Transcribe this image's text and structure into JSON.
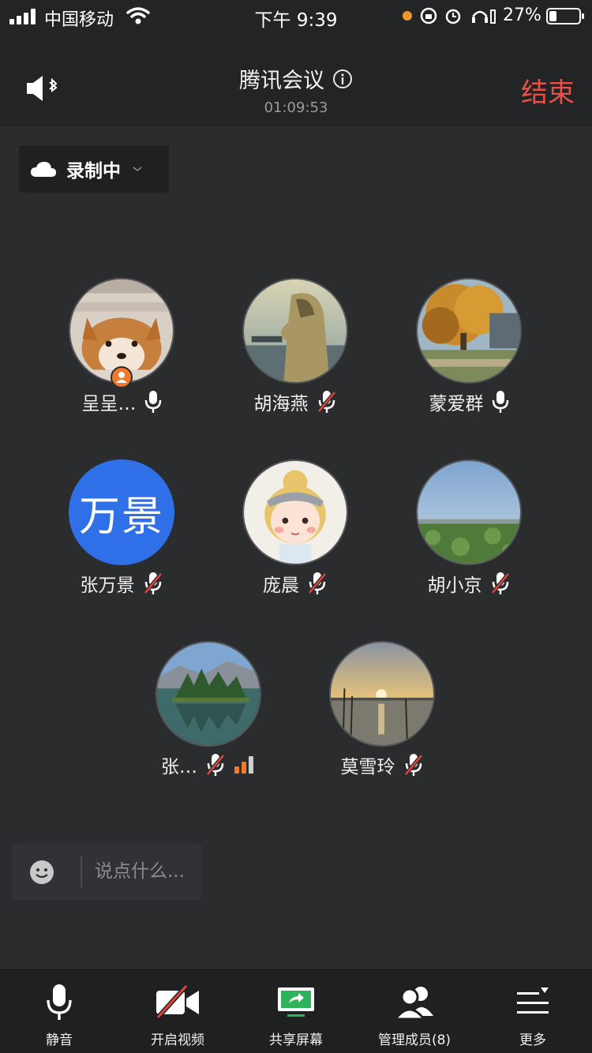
{
  "status_bar": {
    "carrier": "中国移动",
    "time": "下午 9:39",
    "battery_percent": "27%"
  },
  "header": {
    "title": "腾讯会议",
    "timer": "01:09:53",
    "end_label": "结束"
  },
  "recording": {
    "label": "录制中"
  },
  "participants": [
    {
      "name": "呈呈…",
      "mic": "on",
      "avatar": "shiba-dog-photo",
      "host": true
    },
    {
      "name": "胡海燕",
      "mic": "muted",
      "avatar": "hooded-figure-photo"
    },
    {
      "name": "蒙爱群",
      "mic": "on",
      "avatar": "autumn-tree-photo"
    },
    {
      "name": "张万景",
      "mic": "muted",
      "avatar_text": "万景"
    },
    {
      "name": "庞晨",
      "mic": "muted",
      "avatar": "cartoon-girl-illustration"
    },
    {
      "name": "胡小京",
      "mic": "muted",
      "avatar": "lotus-field-photo"
    },
    {
      "name": "张…",
      "mic": "muted",
      "avatar": "lake-island-photo",
      "signal": "weak"
    },
    {
      "name": "莫雪玲",
      "mic": "muted",
      "avatar": "sunset-lake-photo"
    }
  ],
  "chat": {
    "placeholder": "说点什么..."
  },
  "toolbar": {
    "items": [
      {
        "label": "静音",
        "icon": "microphone-icon"
      },
      {
        "label": "开启视频",
        "icon": "video-off-icon"
      },
      {
        "label": "共享屏幕",
        "icon": "share-screen-icon"
      },
      {
        "label": "管理成员(8)",
        "icon": "members-icon"
      },
      {
        "label": "更多",
        "icon": "more-menu-icon"
      }
    ]
  },
  "colors": {
    "end_red": "#e9504a",
    "avatar_blue": "#2f6fe8",
    "muted_red": "#e0443e",
    "signal_orange": "#f0792b",
    "share_green": "#2fb35a"
  }
}
